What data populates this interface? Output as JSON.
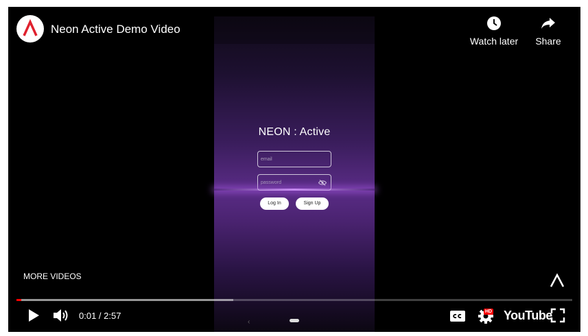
{
  "video": {
    "title": "Neon Active Demo Video",
    "channel_logo_icon": "neon-a-logo-icon"
  },
  "top_actions": {
    "watch_later_label": "Watch later",
    "share_label": "Share"
  },
  "phone_screen": {
    "app_title": "NEON : Active",
    "email_placeholder": "email",
    "password_placeholder": "password",
    "login_label": "Log In",
    "signup_label": "Sign Up",
    "nav_back": "‹"
  },
  "overlay": {
    "more_videos_label": "MORE VIDEOS"
  },
  "controls": {
    "time": "0:01 / 2:57",
    "youtube_label": "YouTube",
    "hd_badge": "HD",
    "played_fraction": 0.0085,
    "buffered_fraction": 0.39
  },
  "colors": {
    "progress_played": "#ff0000",
    "logo_accent": "#e0212e",
    "hd_badge": "#ff0000"
  }
}
